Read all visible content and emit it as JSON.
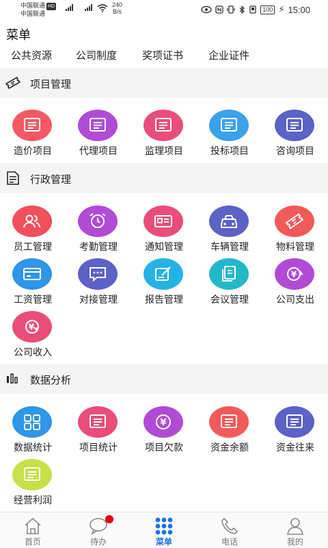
{
  "status_bar": {
    "carrier1": "中国联通",
    "carrier1_badge": "HD",
    "carrier2": "中国联通",
    "net_speed": "240",
    "net_unit": "B/s",
    "battery": "100",
    "time": "15:00"
  },
  "page_title": "菜单",
  "top_tabs": [
    "公共资源",
    "公司制度",
    "奖项证书",
    "企业证件"
  ],
  "sections": [
    {
      "title": "项目管理",
      "icon": "ticket-icon",
      "items": [
        {
          "label": "造价项目",
          "color": "#f25a63",
          "icon": "list-icon"
        },
        {
          "label": "代理项目",
          "color": "#b04bd6",
          "icon": "list-icon"
        },
        {
          "label": "监理项目",
          "color": "#ea4d7a",
          "icon": "list-icon"
        },
        {
          "label": "投标项目",
          "color": "#3aa1ea",
          "icon": "list-icon"
        },
        {
          "label": "咨询项目",
          "color": "#5c62c6",
          "icon": "list-icon"
        }
      ]
    },
    {
      "title": "行政管理",
      "icon": "document-icon",
      "items": [
        {
          "label": "员工管理",
          "color": "#f0505a",
          "icon": "users-icon"
        },
        {
          "label": "考勤管理",
          "color": "#b04bd6",
          "icon": "alarm-clock-icon"
        },
        {
          "label": "通知管理",
          "color": "#ea4d7a",
          "icon": "id-card-icon"
        },
        {
          "label": "车辆管理",
          "color": "#5c62c6",
          "icon": "car-icon"
        },
        {
          "label": "物料管理",
          "color": "#f25a5a",
          "icon": "tag-icon"
        },
        {
          "label": "工资管理",
          "color": "#2f96e8",
          "icon": "card-icon"
        },
        {
          "label": "对接管理",
          "color": "#5c62c6",
          "icon": "chat-icon"
        },
        {
          "label": "报告管理",
          "color": "#25b3e6",
          "icon": "edit-icon"
        },
        {
          "label": "会议管理",
          "color": "#22b8c8",
          "icon": "copy-icon"
        },
        {
          "label": "公司支出",
          "color": "#b04bd6",
          "icon": "yuan-out-icon"
        },
        {
          "label": "公司收入",
          "color": "#ea4d7a",
          "icon": "yuan-in-icon"
        }
      ]
    },
    {
      "title": "数据分析",
      "icon": "bar-chart-icon",
      "items": [
        {
          "label": "数据统计",
          "color": "#2f96e8",
          "icon": "grid-icon"
        },
        {
          "label": "项目统计",
          "color": "#ea4d7a",
          "icon": "list-icon"
        },
        {
          "label": "项目欠款",
          "color": "#b04bd6",
          "icon": "yuan-icon"
        },
        {
          "label": "资金余额",
          "color": "#f25a5a",
          "icon": "list-icon"
        },
        {
          "label": "资金往来",
          "color": "#5c62c6",
          "icon": "list-icon"
        },
        {
          "label": "经营利润",
          "color": "#c8e04a",
          "icon": "list-icon"
        }
      ]
    }
  ],
  "bottom_tabs": [
    {
      "label": "首页",
      "icon": "home-icon"
    },
    {
      "label": "待办",
      "icon": "chat-bubble-icon"
    },
    {
      "label": "菜单",
      "icon": "dots-grid-icon"
    },
    {
      "label": "电话",
      "icon": "phone-icon"
    },
    {
      "label": "我的",
      "icon": "person-icon"
    }
  ],
  "colors": {
    "accent": "#1a73e8",
    "badge": "#e60012",
    "section_bg": "#f4f4f4"
  }
}
